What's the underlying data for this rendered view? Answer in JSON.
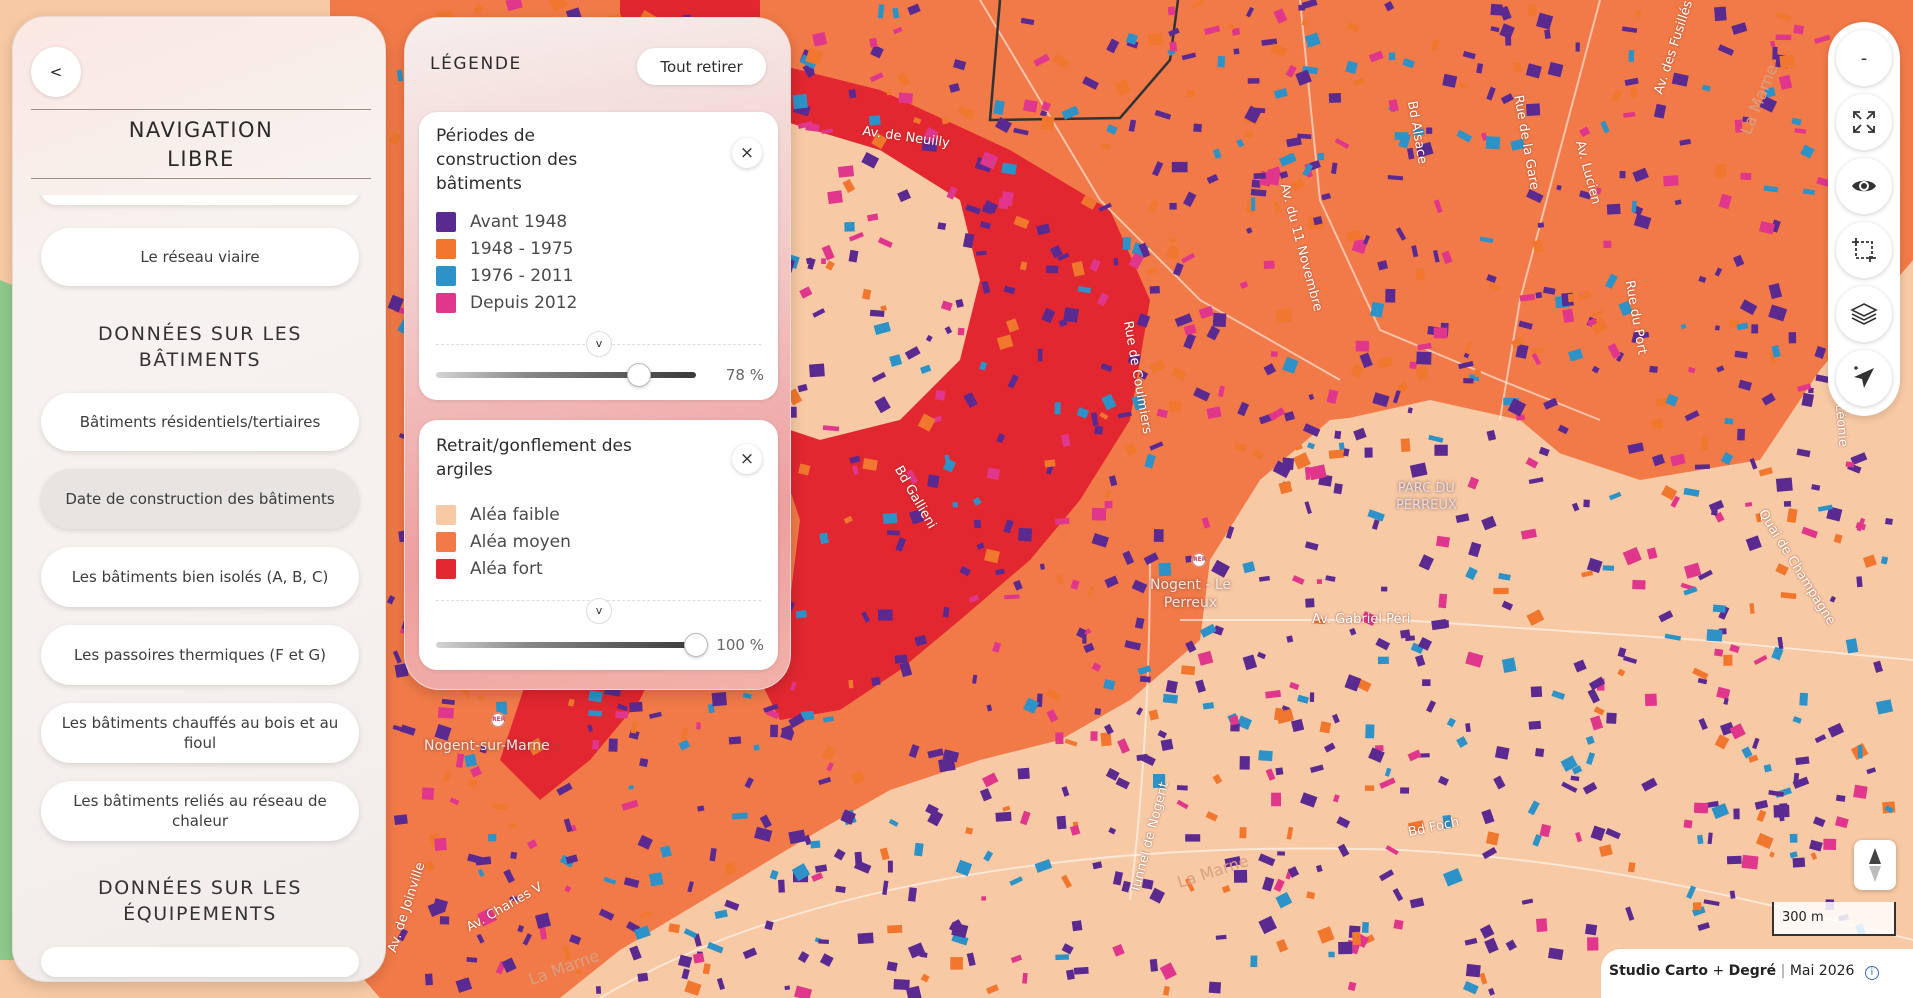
{
  "colors": {
    "avant_1948": "#5b2a91",
    "p1948_1975": "#f0772d",
    "p1976_2011": "#2c92c7",
    "depuis_2012": "#e0368b",
    "alea_faible": "#f7c9a4",
    "alea_moyen": "#f27a48",
    "alea_fort": "#e22730"
  },
  "nav": {
    "back_label": "<",
    "title": "NAVIGATION\nLIBRE",
    "items": [
      {
        "label": "Le réseau viaire"
      },
      {
        "label": "Bâtiments résidentiels/tertiaires"
      },
      {
        "label": "Date de construction des bâtiments"
      },
      {
        "label": "Les bâtiments bien isolés (A, B, C)"
      },
      {
        "label": "Les passoires thermiques (F et G)"
      },
      {
        "label": "Les bâtiments chauffés au bois et au fioul"
      },
      {
        "label": "Les bâtiments reliés au réseau de chaleur"
      }
    ],
    "sections": [
      {
        "label": "DONNÉES SUR LES\nBÂTIMENTS"
      },
      {
        "label": "DONNÉES SUR LES\nÉQUIPEMENTS"
      }
    ]
  },
  "legend": {
    "title": "LÉGENDE",
    "remove_all_label": "Tout retirer",
    "close_icon": "×",
    "expand_icon": "v",
    "cards": [
      {
        "title": "Périodes de\nconstruction des\nbâtiments",
        "items": [
          {
            "label": "Avant 1948",
            "color": "#5b2a91"
          },
          {
            "label": "1948 - 1975",
            "color": "#f0772d"
          },
          {
            "label": "1976 - 2011",
            "color": "#2c92c7"
          },
          {
            "label": "Depuis 2012",
            "color": "#e0368b"
          }
        ],
        "opacity": 0.78,
        "opacity_label": "78 %"
      },
      {
        "title": "Retrait/gonflement des\nargiles",
        "items": [
          {
            "label": "Aléa faible",
            "color": "#f7c9a4"
          },
          {
            "label": "Aléa moyen",
            "color": "#f27a48"
          },
          {
            "label": "Aléa fort",
            "color": "#e22730"
          }
        ],
        "opacity": 1.0,
        "opacity_label": "100 %"
      }
    ]
  },
  "toolbar": {
    "zoom_out_label": "-",
    "icons": [
      "fullscreen-icon",
      "eye-icon",
      "select-area-icon",
      "layers-icon",
      "locate-icon"
    ]
  },
  "map": {
    "streets": [
      {
        "text": "Av. de Neuilly"
      },
      {
        "text": "Rue de Coulmiers"
      },
      {
        "text": "Bd Gallieni"
      },
      {
        "text": "Av. du 11 Novembre"
      },
      {
        "text": "Bd Alsace"
      },
      {
        "text": "Rue de la Gare"
      },
      {
        "text": "Rue du Port"
      },
      {
        "text": "Av. Gabriel Péri"
      },
      {
        "text": "Bd Foch"
      },
      {
        "text": "Tunnel de Nogent"
      },
      {
        "text": "Av. Charles V"
      },
      {
        "text": "Quai de Champagne"
      },
      {
        "text": "Av. de Joinville"
      },
      {
        "text": "Av. des Fusillés"
      },
      {
        "text": "Av. Lucien"
      },
      {
        "text": "Allée Léonie"
      }
    ],
    "places": [
      {
        "text": "Nogent - Le\nPerreux"
      },
      {
        "text": "Nogent-sur-Marne"
      },
      {
        "text": "PARC DU\nPERREUX"
      }
    ],
    "water": [
      {
        "text": "La Marne"
      },
      {
        "text": "La Marne"
      },
      {
        "text": "La Marne"
      }
    ],
    "rer_badge": "RER"
  },
  "scale": {
    "label": "300 m"
  },
  "attribution": {
    "studio": "Studio Carto",
    "plus": "+",
    "degre": "Degré",
    "pipe": "|",
    "date": "Mai 2026",
    "info_icon": "i"
  }
}
